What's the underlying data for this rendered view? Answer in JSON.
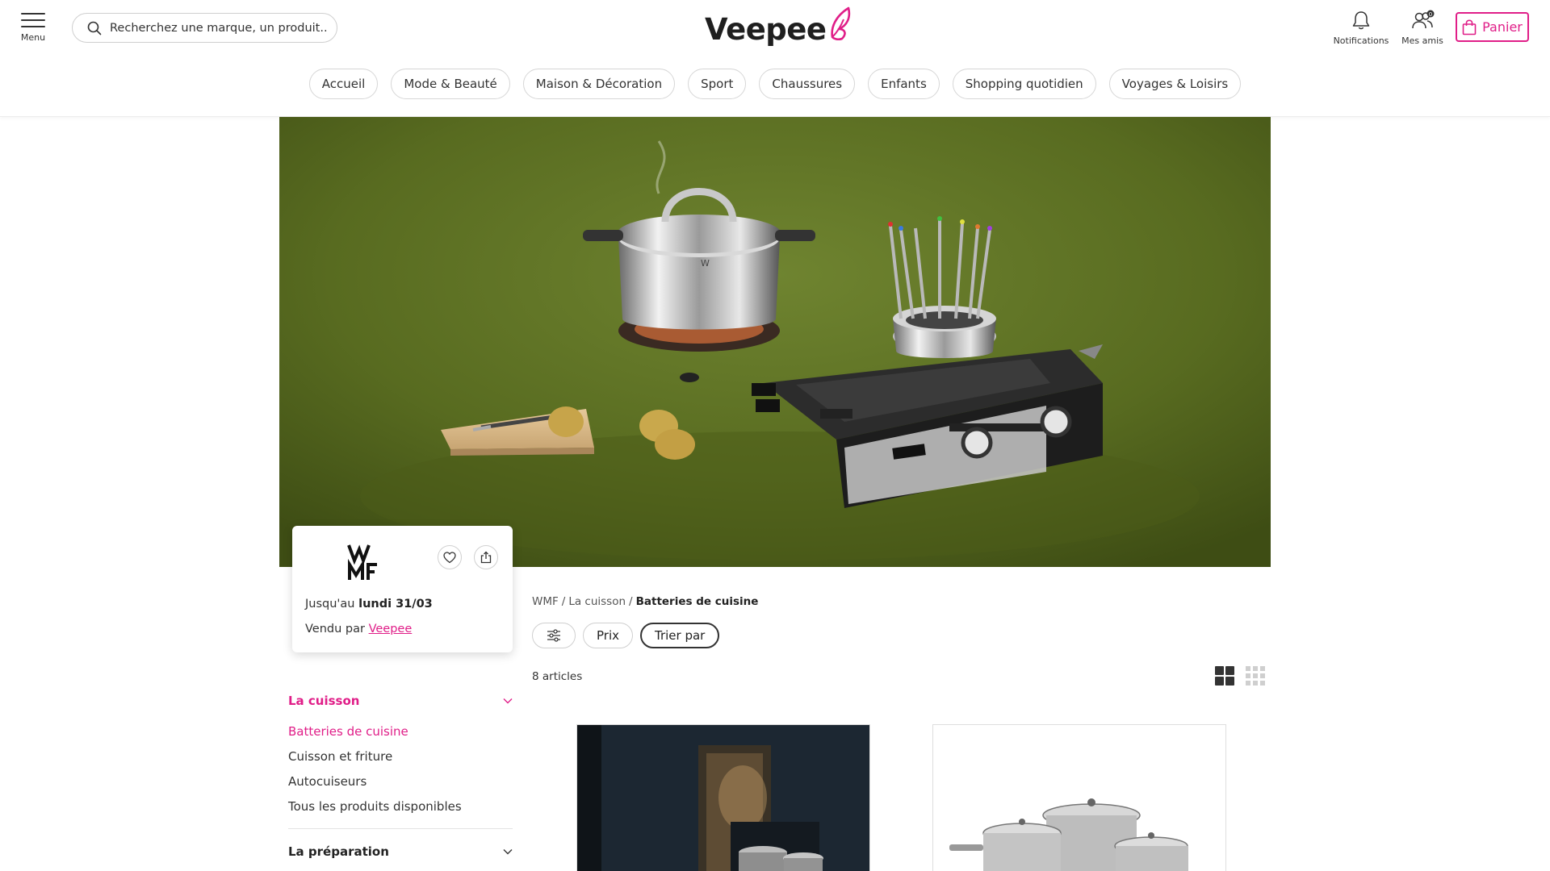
{
  "header": {
    "menu_label": "Menu",
    "search_placeholder": "Recherchez une marque, un produit...",
    "logo_text": "Veepee",
    "notifications_label": "Notifications",
    "friends_label": "Mes amis",
    "friends_badge": "0",
    "cart_label": "Panier"
  },
  "nav": {
    "items": [
      "Accueil",
      "Mode & Beauté",
      "Maison & Décoration",
      "Sport",
      "Chaussures",
      "Enfants",
      "Shopping quotidien",
      "Voyages & Loisirs"
    ]
  },
  "brand_card": {
    "logo_letters": "WMF",
    "until_prefix": "Jusqu'au",
    "until_date": "lundi 31/03",
    "sold_prefix": "Vendu par",
    "seller": "Veepee"
  },
  "breadcrumb": {
    "items": [
      "WMF",
      "La cuisson"
    ],
    "separator": "/",
    "current": "Batteries de cuisine"
  },
  "filters": {
    "filter_icon": "sliders-icon",
    "price": "Prix",
    "sort": "Trier par"
  },
  "results": {
    "count": "8 articles"
  },
  "sidebar": {
    "categories": [
      {
        "label": "La cuisson",
        "expanded": true,
        "items": [
          {
            "label": "Batteries de cuisine",
            "active": true
          },
          {
            "label": "Cuisson et friture",
            "active": false
          },
          {
            "label": "Autocuiseurs",
            "active": false
          },
          {
            "label": "Tous les produits disponibles",
            "active": false
          }
        ]
      },
      {
        "label": "La préparation",
        "expanded": false
      }
    ]
  },
  "colors": {
    "accent": "#e01e88",
    "hero_background": "#5d6e22",
    "text": "#222222"
  }
}
